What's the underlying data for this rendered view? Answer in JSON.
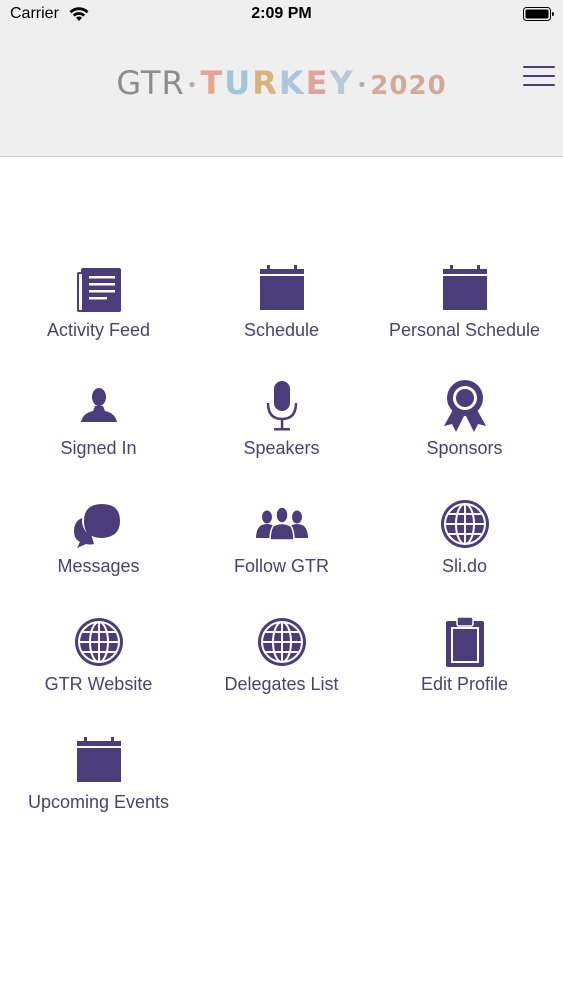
{
  "status_bar": {
    "carrier": "Carrier",
    "time": "2:09 PM"
  },
  "header": {
    "logo": {
      "part1": "GTR",
      "separator": "•",
      "part2_letters": [
        "T",
        "U",
        "R",
        "K",
        "E",
        "Y"
      ],
      "part3": "2020"
    },
    "logo_colors": [
      "#e8a48e",
      "#9fc7d9",
      "#d9b27c",
      "#a9c8e0",
      "#e0a39b",
      "#b8c9de"
    ],
    "menu_icon": "hamburger-icon"
  },
  "colors": {
    "accent": "#4a3d7a",
    "label": "#4a4272",
    "header_bg": "#efefef"
  },
  "menu": {
    "items": [
      {
        "label": "Activity Feed",
        "icon": "newsfeed-icon"
      },
      {
        "label": "Schedule",
        "icon": "calendar-icon"
      },
      {
        "label": "Personal Schedule",
        "icon": "calendar-icon"
      },
      {
        "label": "Signed In",
        "icon": "person-icon"
      },
      {
        "label": "Speakers",
        "icon": "microphone-icon"
      },
      {
        "label": "Sponsors",
        "icon": "award-icon"
      },
      {
        "label": "Messages",
        "icon": "chat-bubbles-icon"
      },
      {
        "label": "Follow GTR",
        "icon": "group-icon"
      },
      {
        "label": "Sli.do",
        "icon": "globe-icon"
      },
      {
        "label": "GTR Website",
        "icon": "globe-icon"
      },
      {
        "label": "Delegates List",
        "icon": "globe-icon"
      },
      {
        "label": "Edit Profile",
        "icon": "clipboard-icon"
      },
      {
        "label": "Upcoming Events",
        "icon": "calendar-icon"
      }
    ]
  }
}
